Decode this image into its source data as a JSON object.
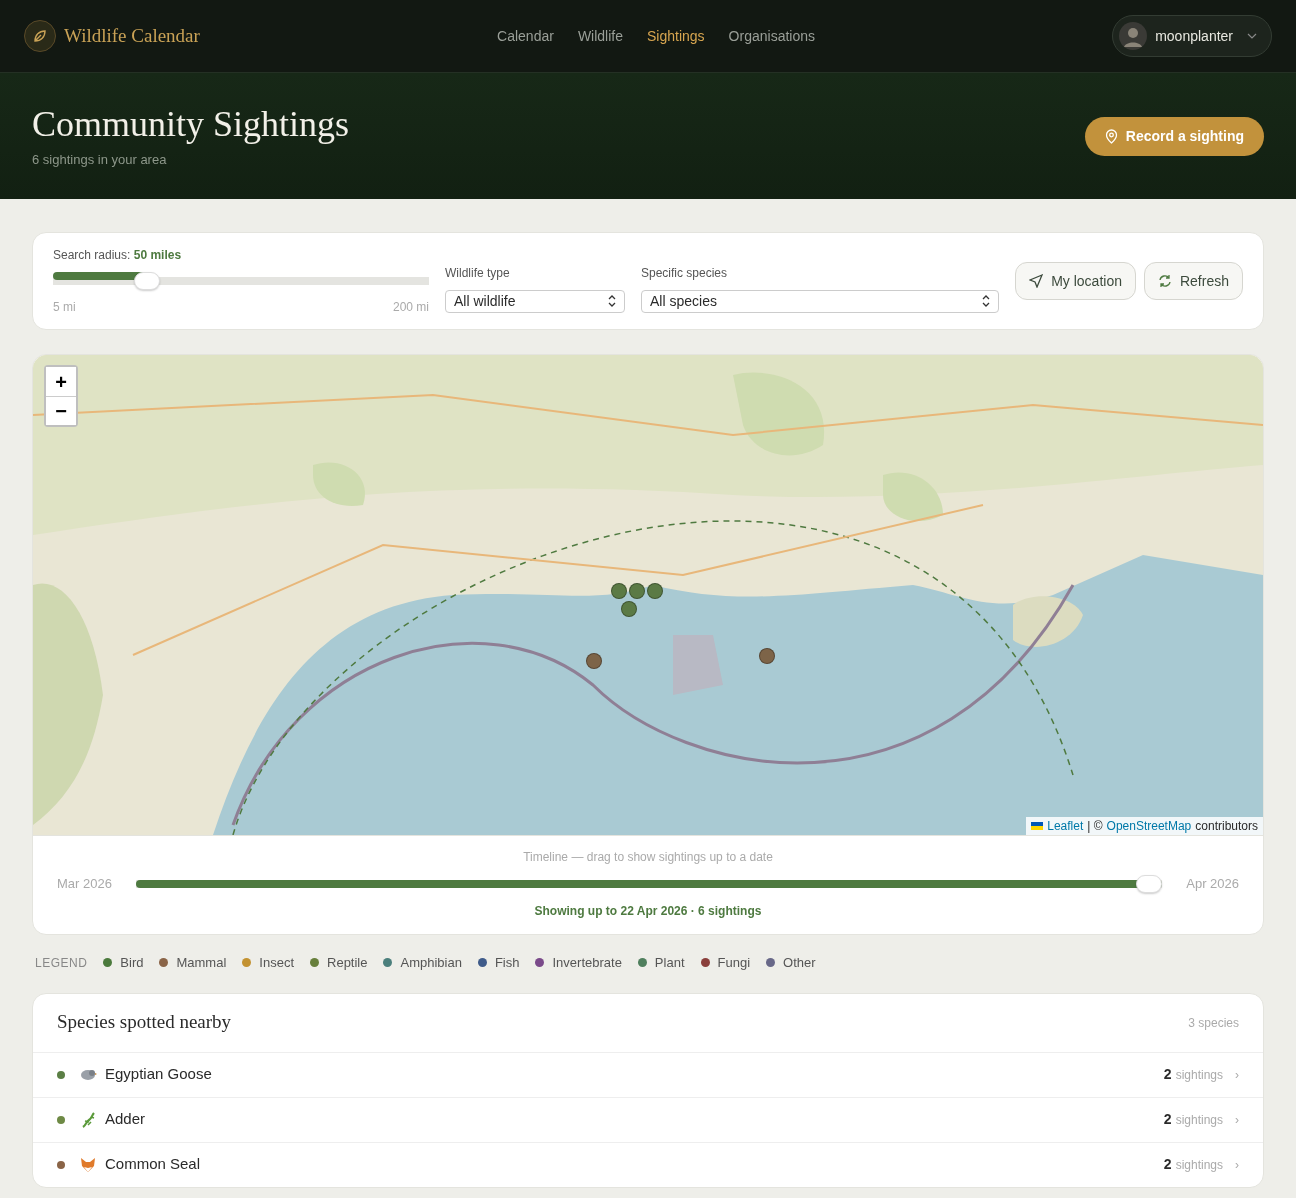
{
  "brand": {
    "title": "Wildlife Calendar"
  },
  "nav": [
    {
      "label": "Calendar",
      "selected": false
    },
    {
      "label": "Wildlife",
      "selected": false
    },
    {
      "label": "Sightings",
      "selected": true
    },
    {
      "label": "Organisations",
      "selected": false
    }
  ],
  "user": {
    "name": "moonplanter"
  },
  "hero": {
    "title": "Community Sightings",
    "subtitle": "6 sightings in your area",
    "button": "Record a sighting"
  },
  "filters": {
    "radius_label": "Search radius:",
    "radius_value": "50 miles",
    "level": 0.25,
    "min": "5 mi",
    "max": "200 mi",
    "type_label": "Wildlife type",
    "type_value": "All wildlife",
    "species_label": "Specific species",
    "species_value": "All species",
    "buttons": [
      "My location",
      "Refresh"
    ]
  },
  "map": {
    "zoom_in": "+",
    "zoom_out": "−",
    "attribution_link1": "Leaflet",
    "attribution_sep": "| ©",
    "attribution_link2": "OpenStreetMap",
    "attribution_tail": "contributors",
    "markers": [
      {
        "color": "#5b7a45"
      },
      {
        "color": "#5b7a45"
      },
      {
        "color": "#5b7a45"
      },
      {
        "color": "#5b7a45"
      },
      {
        "color": "#7d6448"
      },
      {
        "color": "#7d6448"
      }
    ]
  },
  "timeline": {
    "hint": "Timeline — drag to show sightings up to a date",
    "start": "Mar 2026",
    "end": "Apr 2026",
    "level": 1,
    "status": "Showing up to 22 Apr 2026 · 6 sightings"
  },
  "legend": {
    "title": "LEGEND",
    "items": [
      {
        "label": "Bird",
        "color": "#4b7a3c"
      },
      {
        "label": "Mammal",
        "color": "#8a6447"
      },
      {
        "label": "Insect",
        "color": "#c39231"
      },
      {
        "label": "Reptile",
        "color": "#677f3b"
      },
      {
        "label": "Amphibian",
        "color": "#4b7f7c"
      },
      {
        "label": "Fish",
        "color": "#3f5b8a"
      },
      {
        "label": "Invertebrate",
        "color": "#7a4a8a"
      },
      {
        "label": "Plant",
        "color": "#4f7f5d"
      },
      {
        "label": "Fungi",
        "color": "#8a3f3b"
      },
      {
        "label": "Other",
        "color": "#686888"
      }
    ]
  },
  "species": {
    "title": "Species spotted nearby",
    "count": "3 species",
    "rows": [
      {
        "name": "Egyptian Goose",
        "kind": "bird",
        "color": "#5b7f45",
        "count": "2",
        "unit": "sightings",
        "chevron": "›"
      },
      {
        "name": "Adder",
        "kind": "reptile",
        "color": "#6e8a45",
        "count": "2",
        "unit": "sightings",
        "chevron": "›"
      },
      {
        "name": "Common Seal",
        "kind": "mammal",
        "color": "#8a6447",
        "count": "2",
        "unit": "sightings",
        "chevron": "›"
      }
    ]
  }
}
